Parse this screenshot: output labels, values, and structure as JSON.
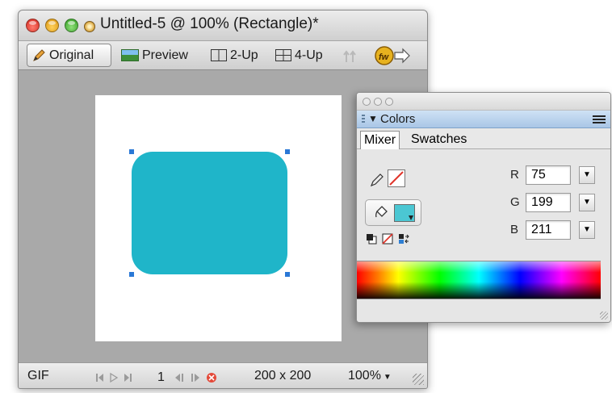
{
  "window": {
    "title": "Untitled-5 @ 100% (Rectangle)*",
    "toolbar": {
      "original_label": "Original",
      "preview_label": "Preview",
      "two_up_label": "2-Up",
      "four_up_label": "4-Up"
    },
    "canvas": {
      "shape_color": "#1fb5c9",
      "artboard_color": "#ffffff"
    },
    "statusbar": {
      "format": "GIF",
      "frame": "1",
      "size": "200 x 200",
      "zoom": "100%"
    }
  },
  "colors_panel": {
    "title": "Colors",
    "tabs": [
      "Mixer",
      "Swatches"
    ],
    "active_tab": "Mixer",
    "fill_color": "#4bc7d3",
    "channels": [
      {
        "label": "R",
        "value": "75"
      },
      {
        "label": "G",
        "value": "199"
      },
      {
        "label": "B",
        "value": "211"
      }
    ]
  },
  "icons": [
    "pencil-icon",
    "preview-icon",
    "two-up-icon",
    "four-up-icon",
    "export-icon",
    "quick-export-icon",
    "first-frame-icon",
    "play-icon",
    "last-frame-icon",
    "prev-frame-icon",
    "next-frame-icon",
    "stop-icon",
    "panel-menu-icon",
    "stroke-pencil-icon",
    "fill-bucket-icon",
    "default-colors-icon",
    "no-color-icon",
    "swap-colors-icon"
  ]
}
